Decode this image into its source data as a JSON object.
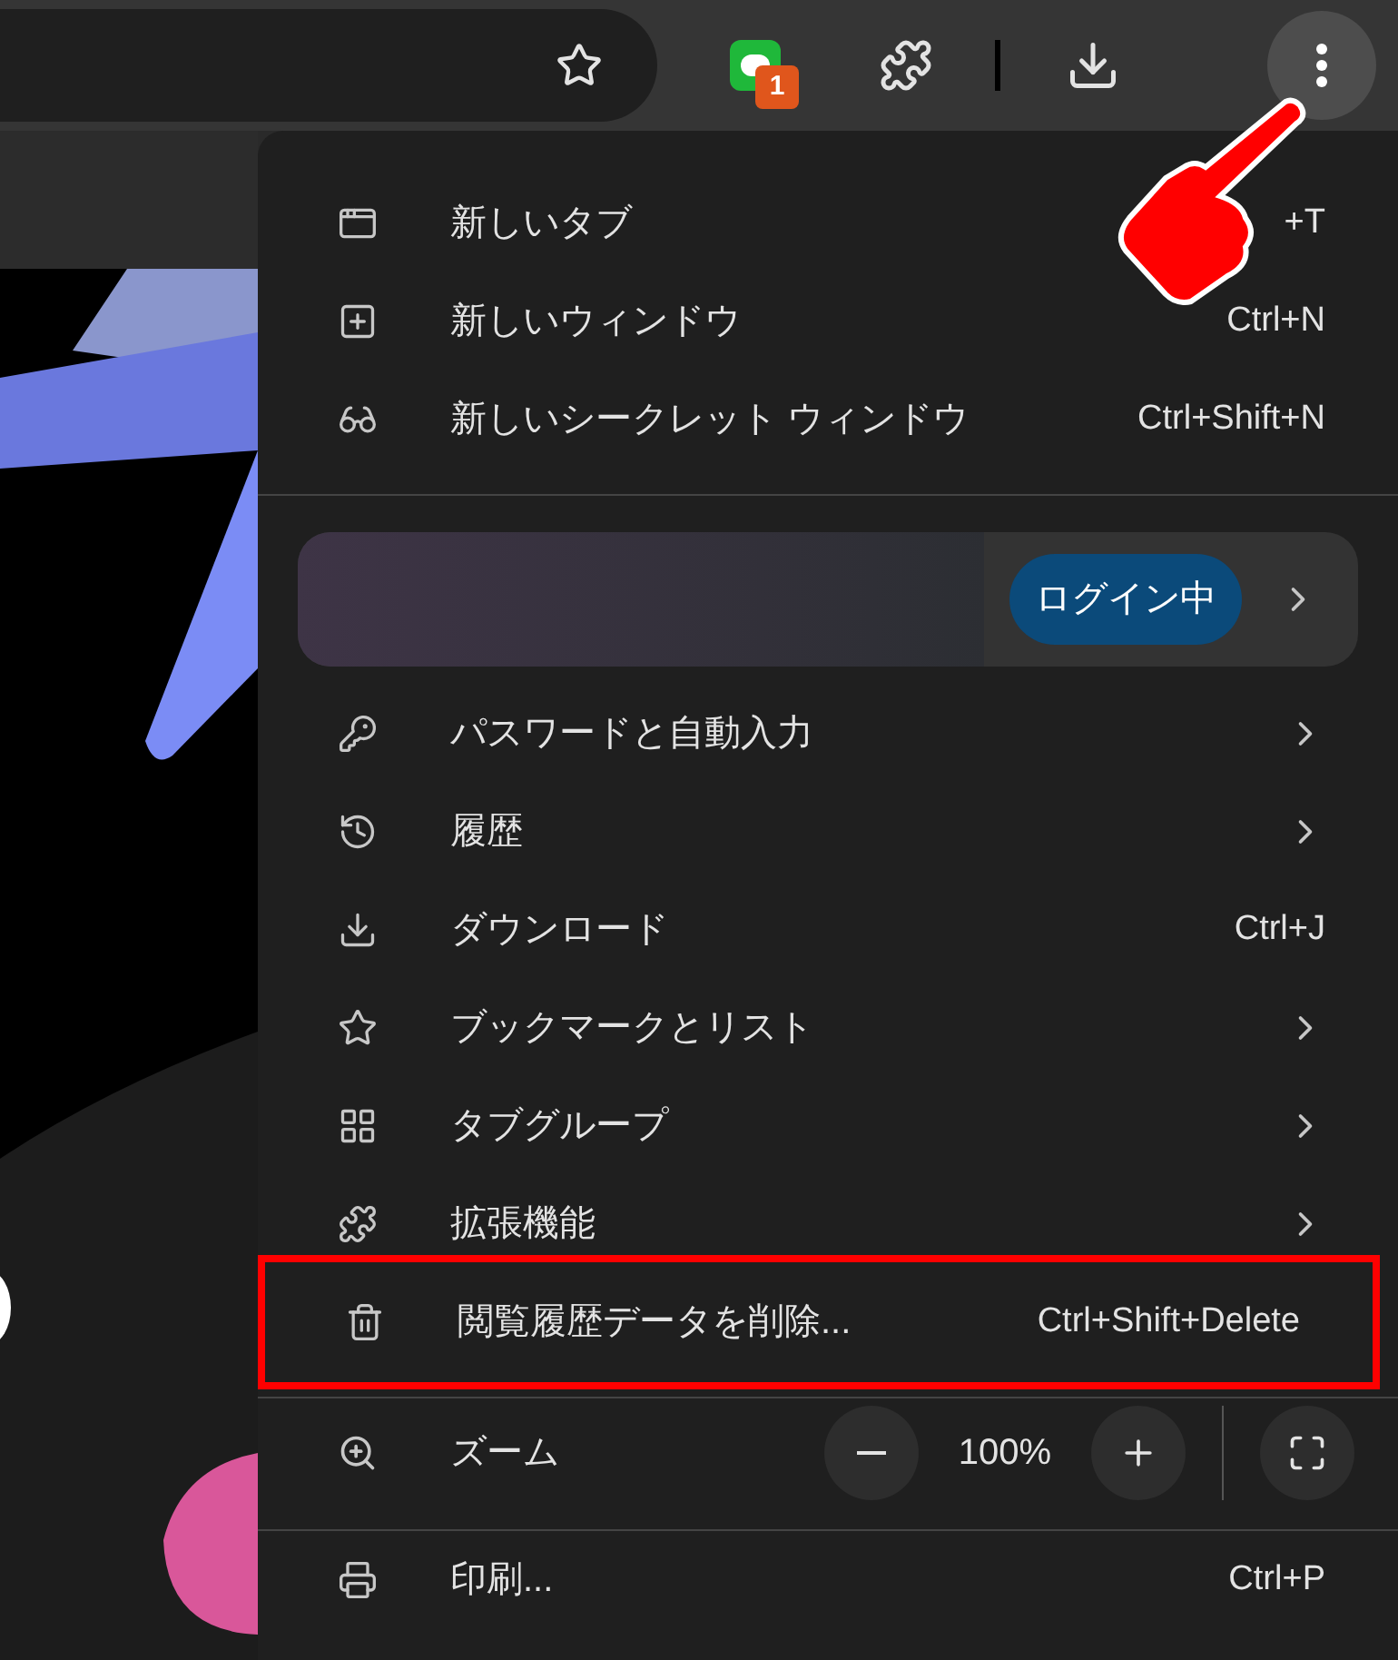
{
  "toolbar": {
    "extension_badge": "1"
  },
  "menu": {
    "groups": [
      [
        {
          "kind": "item",
          "label": "新しいタブ",
          "shortcut": "+T",
          "submenu": false,
          "highlighted": false
        },
        {
          "kind": "item",
          "label": "新しいウィンドウ",
          "shortcut": "Ctrl+N",
          "submenu": false,
          "highlighted": false
        },
        {
          "kind": "item",
          "label": "新しいシークレット ウィンドウ",
          "shortcut": "Ctrl+Shift+N",
          "submenu": false,
          "highlighted": false
        }
      ],
      [
        {
          "kind": "profile",
          "badge": "ログイン中",
          "submenu": true
        },
        {
          "kind": "item",
          "label": "パスワードと自動入力",
          "submenu": true,
          "highlighted": false
        },
        {
          "kind": "item",
          "label": "履歴",
          "submenu": true,
          "highlighted": false
        },
        {
          "kind": "item",
          "label": "ダウンロード",
          "shortcut": "Ctrl+J",
          "submenu": false,
          "highlighted": false
        },
        {
          "kind": "item",
          "label": "ブックマークとリスト",
          "submenu": true,
          "highlighted": false
        },
        {
          "kind": "item",
          "label": "タブグループ",
          "submenu": true,
          "highlighted": false
        },
        {
          "kind": "item",
          "label": "拡張機能",
          "submenu": true,
          "highlighted": false
        },
        {
          "kind": "item",
          "label": "閲覧履歴データを削除...",
          "shortcut": "Ctrl+Shift+Delete",
          "submenu": false,
          "highlighted": true
        }
      ],
      [
        {
          "kind": "zoom",
          "label": "ズーム",
          "value": "100%"
        }
      ],
      [
        {
          "kind": "item",
          "label": "印刷...",
          "shortcut": "Ctrl+P",
          "submenu": false,
          "highlighted": false
        }
      ]
    ]
  }
}
